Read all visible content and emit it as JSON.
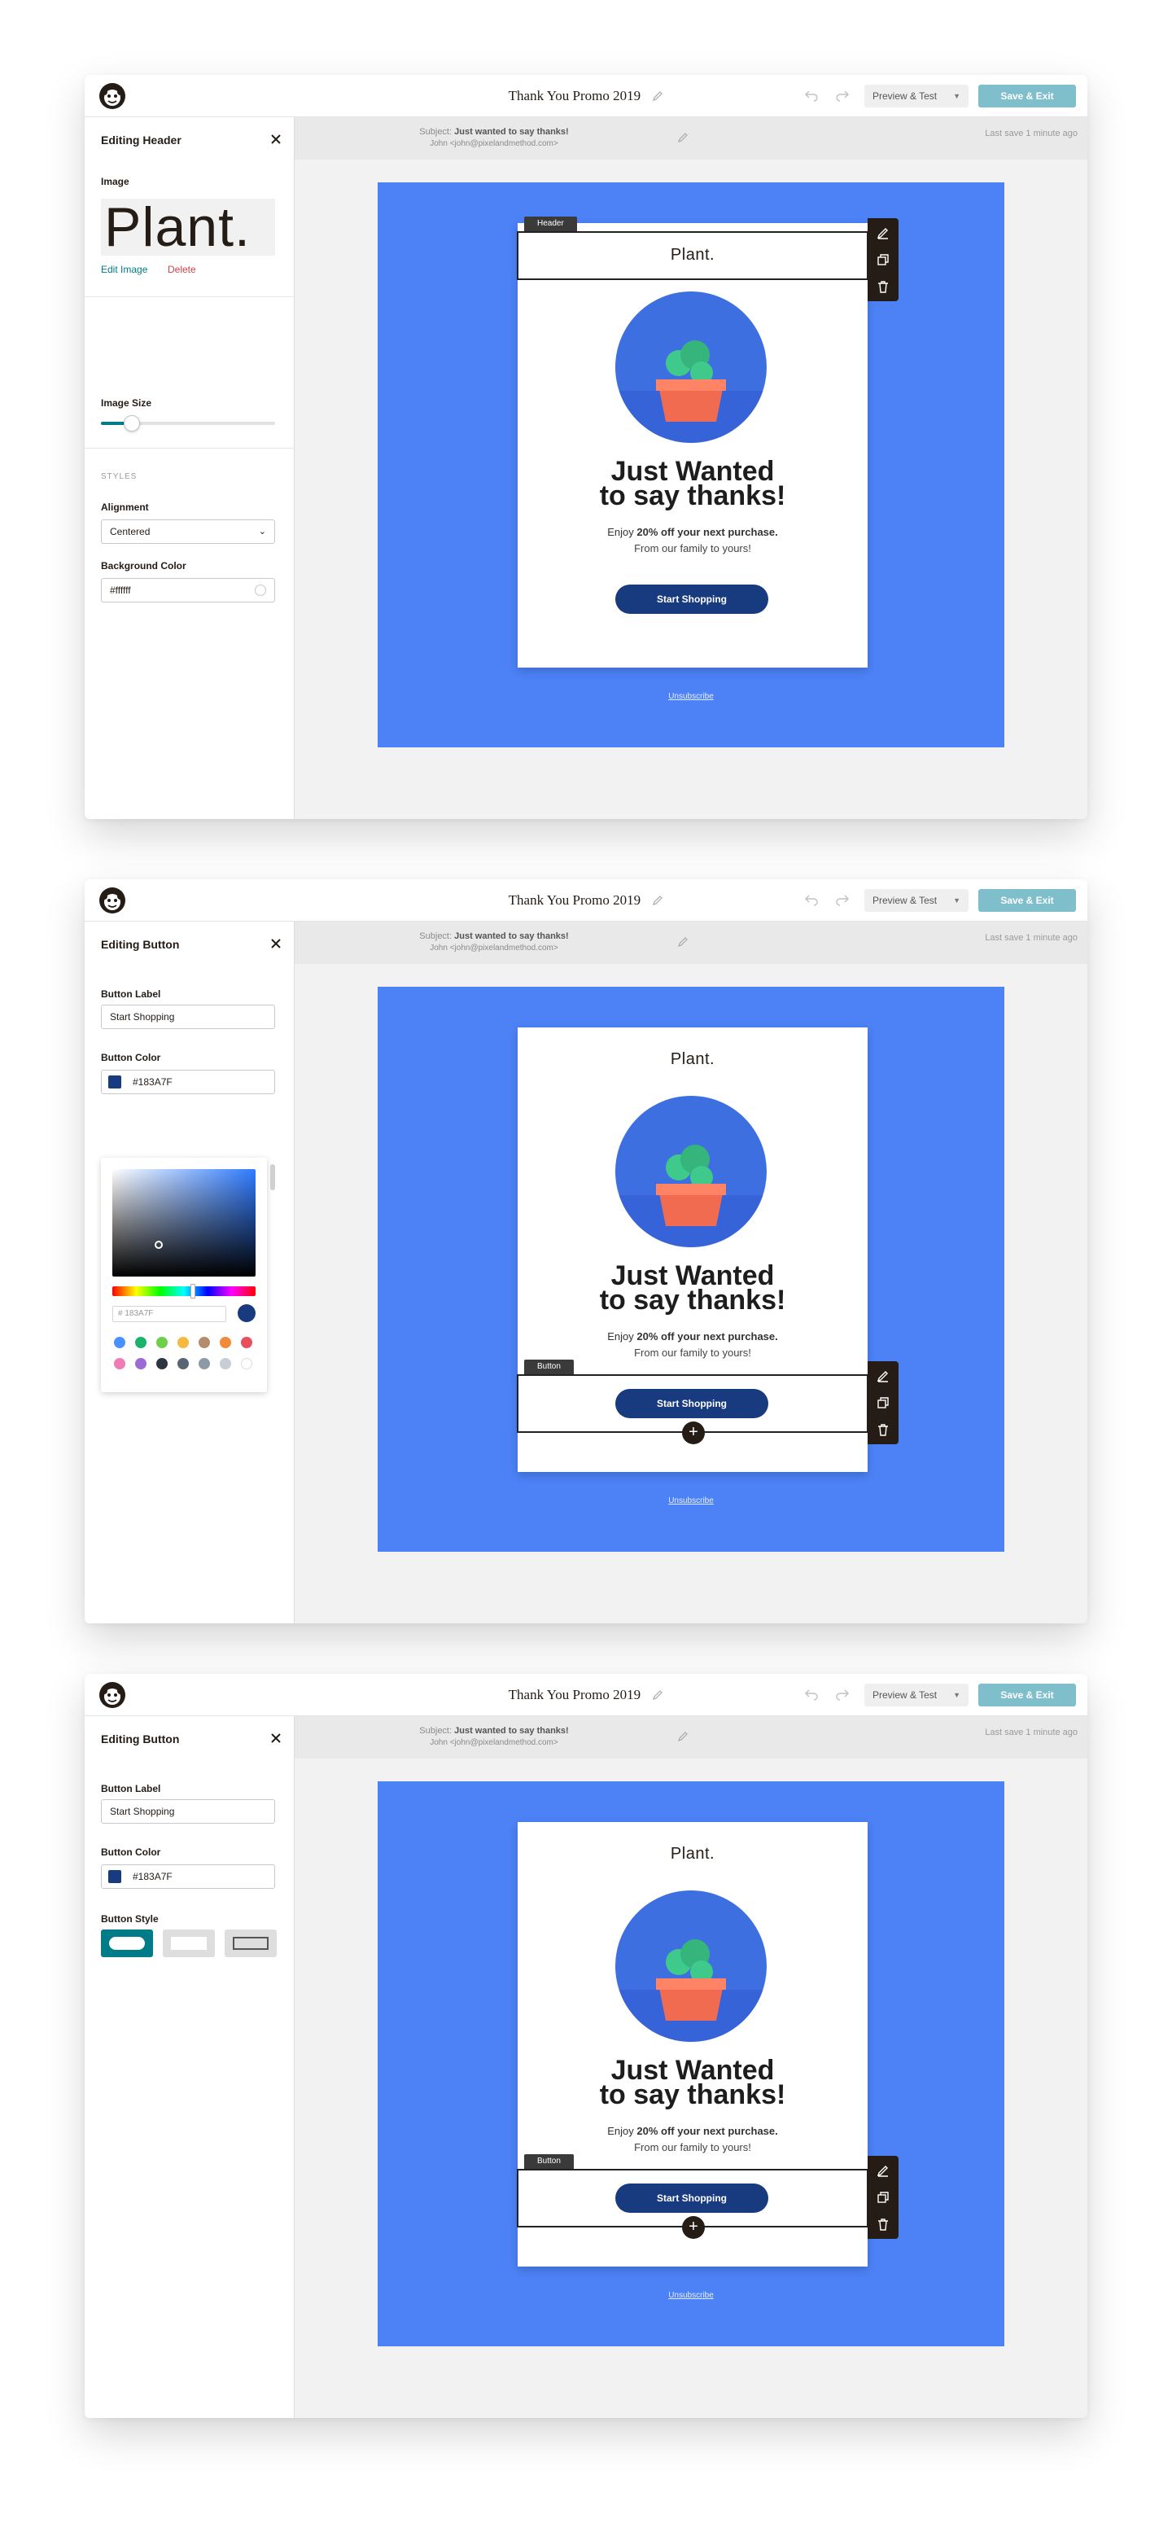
{
  "app": {
    "campaign_title": "Thank You Promo 2019",
    "preview_label": "Preview & Test",
    "save_label": "Save & Exit",
    "subject_prefix": "Subject:",
    "subject": "Just wanted to say thanks!",
    "from": "John <john@pixelandmethod.com>",
    "last_save": "Last save 1 minute ago"
  },
  "email": {
    "brand": "Plant.",
    "headline_line1": "Just Wanted",
    "headline_line2": "to say thanks!",
    "offer_prefix": "Enjoy ",
    "offer_bold": "20% off your next purchase.",
    "family": "From our family to yours!",
    "cta": "Start Shopping",
    "unsubscribe": "Unsubscribe"
  },
  "panel_header": {
    "title": "Editing Header",
    "image_label": "Image",
    "image_preview_text": "Plant.",
    "edit_image": "Edit Image",
    "delete": "Delete",
    "image_size_label": "Image Size",
    "image_size_value": 0.18,
    "styles_heading": "STYLES",
    "alignment_label": "Alignment",
    "alignment_value": "Centered",
    "bg_color_label": "Background Color",
    "bg_color_value": "#ffffff",
    "tag": "Header"
  },
  "panel_button": {
    "title": "Editing Button",
    "label_label": "Button Label",
    "label_value": "Start Shopping",
    "color_label": "Button Color",
    "color_value": "#183A7F",
    "hex_input": "183A7F",
    "style_label": "Button Style",
    "tag": "Button"
  },
  "colors": {
    "brand_blue": "#4c82f6",
    "button_navy": "#183a7f",
    "teal": "#007c89",
    "save_teal": "#7fbecb",
    "presets_row1": [
      "#4a90ff",
      "#1bb36b",
      "#6fcf4b",
      "#f5b942",
      "#b38b6d",
      "#f08a3c",
      "#e8505b"
    ],
    "presets_row2": [
      "#f07cb6",
      "#9b6bd6",
      "#2d3542",
      "#5a6573",
      "#8e99a6",
      "#c7ced6",
      "#ffffff"
    ]
  },
  "icons": [
    "mailchimp-logo",
    "pencil-icon",
    "undo-icon",
    "redo-icon",
    "close-icon",
    "edit-icon",
    "duplicate-icon",
    "trash-icon",
    "plus-icon",
    "chevron-down-icon"
  ]
}
